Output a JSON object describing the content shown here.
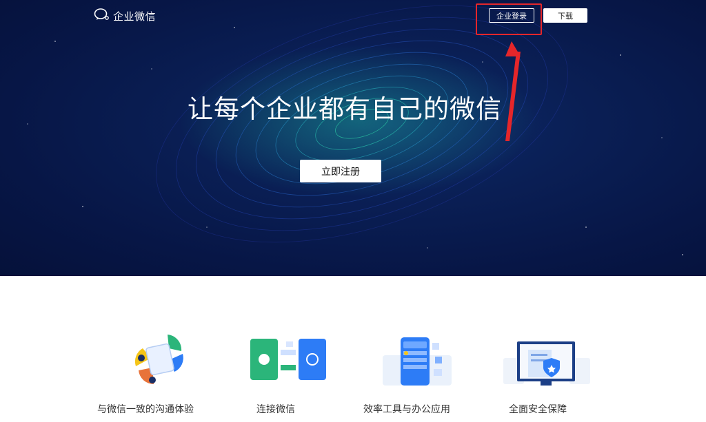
{
  "header": {
    "logo_text": "企业微信",
    "login_label": "企业登录",
    "download_label": "下载"
  },
  "hero": {
    "title": "让每个企业都有自己的微信",
    "register_label": "立即注册"
  },
  "features": [
    {
      "label": "与微信一致的沟通体验",
      "icon": "chat-experience-icon"
    },
    {
      "label": "连接微信",
      "icon": "connect-wechat-icon"
    },
    {
      "label": "效率工具与办公应用",
      "icon": "office-tools-icon"
    },
    {
      "label": "全面安全保障",
      "icon": "security-icon"
    }
  ],
  "colors": {
    "hero_bg": "#071646",
    "accent_green": "#2bb57a",
    "accent_blue": "#2d7cf6",
    "highlight_red": "#e5262a"
  }
}
